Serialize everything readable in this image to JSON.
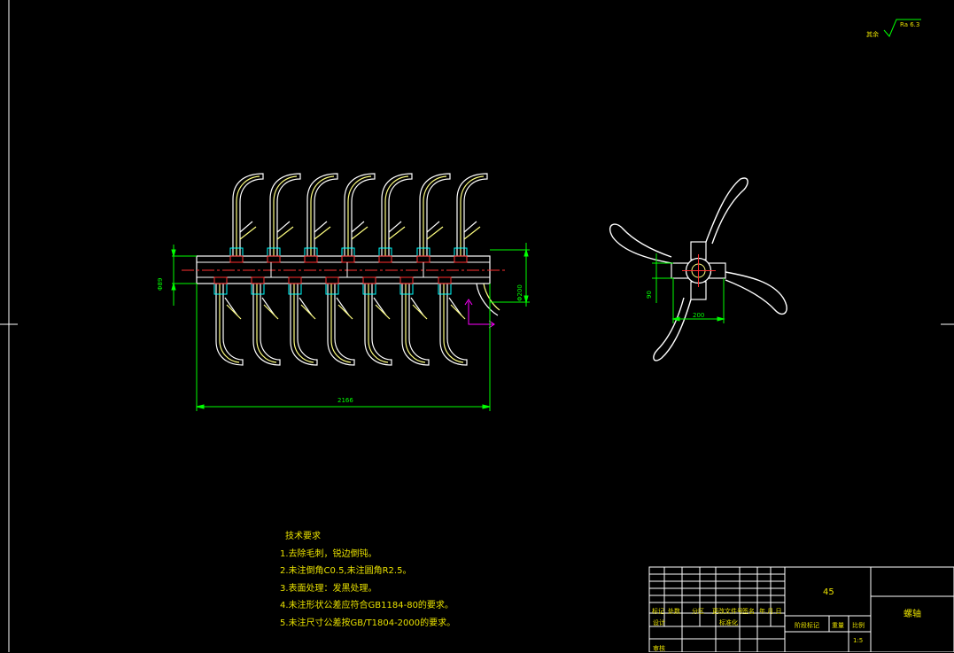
{
  "roughness": {
    "prefix": "其余",
    "symbol": "Ra 6.3"
  },
  "dimensions": {
    "overall_length": "2166",
    "shaft_dia": "Φ89",
    "blade_dia": "Φ200",
    "hub_height": "90",
    "hub_width": "200"
  },
  "tech_notes": {
    "title": "技术要求",
    "items": [
      "1.去除毛刺，锐边倒钝。",
      "2.未注倒角C0.5,未注圆角R2.5。",
      "3.表面处理：发黑处理。",
      "4.未注形状公差应符合GB1184-80的要求。",
      "5.未注尺寸公差按GB/T1804-2000的要求。"
    ]
  },
  "title_block": {
    "material": "45",
    "part_name": "螺轴",
    "headers": [
      "标记",
      "处数",
      "分区",
      "更改文件号",
      "签名",
      "年.月.日"
    ],
    "design": "设计",
    "standardization": "标准化",
    "stage_mark": "阶段标记",
    "weight": "重量",
    "scale_label": "比例",
    "scale": "1:5",
    "review": "审核"
  },
  "colors": {
    "background": "#000000",
    "outline": "#ffffff",
    "profile": "#ffff80",
    "dimension": "#00ff00",
    "hatch": "#00ffff",
    "center": "#ff3030",
    "ucs": "#ff00ff",
    "text": "#e8e000"
  }
}
